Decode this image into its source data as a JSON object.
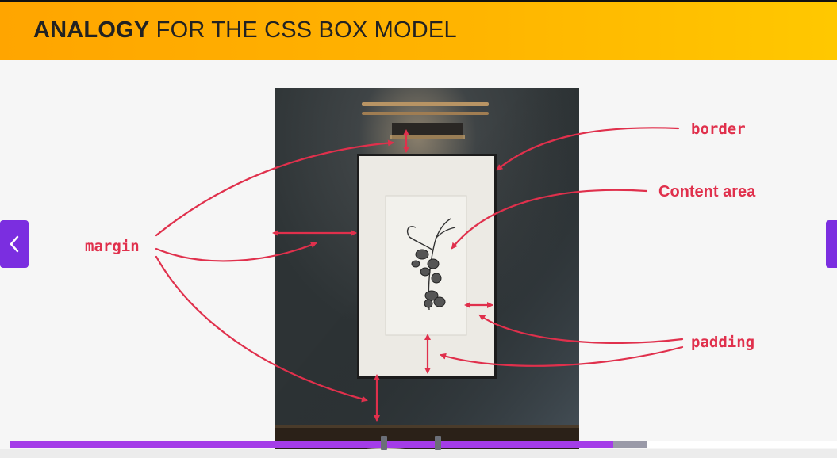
{
  "header": {
    "title_strong": "ANALOGY",
    "title_rest": " FOR THE CSS BOX MODEL"
  },
  "labels": {
    "border": "border",
    "content_area": "Content area",
    "margin": "margin",
    "padding": "padding"
  },
  "colors": {
    "accent": "#e0304c",
    "header_start": "#ffa500",
    "header_end": "#ffc800",
    "nav_button": "#7b2ee0",
    "progress_fill": "#a43ce8"
  },
  "icons": {
    "prev": "chevron-left-icon",
    "next": "chevron-right-icon"
  },
  "progress": {
    "played_fraction": 0.73,
    "buffered_fraction": 0.77
  }
}
